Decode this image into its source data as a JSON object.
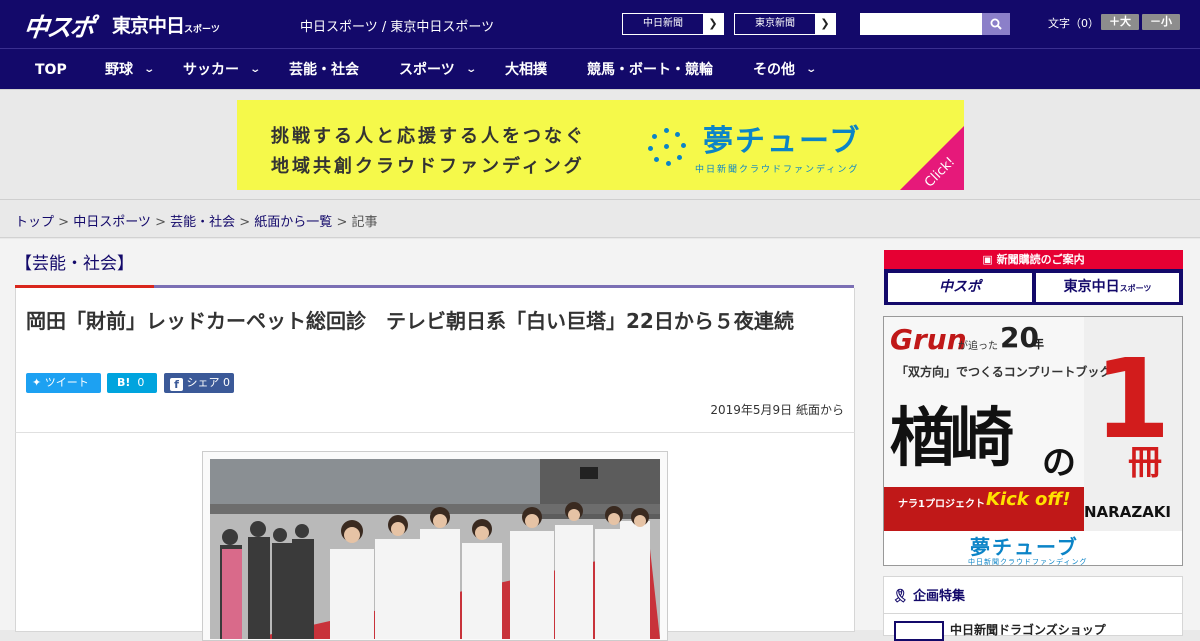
{
  "header": {
    "logo_main": "中スポ",
    "logo_tokyo": "東京中日",
    "logo_tokyo_small": "スポーツ",
    "site_name": "中日スポーツ / 東京中日スポーツ",
    "btn_chunichi": "中日新聞",
    "btn_tokyo": "東京新聞",
    "search_placeholder": "",
    "font_label": "文字（0）",
    "font_bigger": "＋大",
    "font_smaller": "－小"
  },
  "nav": {
    "items": [
      {
        "label": "TOP",
        "has_menu": false
      },
      {
        "label": "野球",
        "has_menu": true
      },
      {
        "label": "サッカー",
        "has_menu": true
      },
      {
        "label": "芸能・社会",
        "has_menu": false
      },
      {
        "label": "スポーツ",
        "has_menu": true
      },
      {
        "label": "大相撲",
        "has_menu": false
      },
      {
        "label": "競馬・ボート・競輪",
        "has_menu": false
      },
      {
        "label": "その他",
        "has_menu": true
      }
    ]
  },
  "ad_banner": {
    "line1": "挑戦する人と応援する人をつなぐ",
    "line2": "地域共創クラウドファンディング",
    "logo": "夢チューブ",
    "sub": "中日新聞クラウドファンディング",
    "click": "Click!"
  },
  "breadcrumb": {
    "items": [
      "トップ",
      "中日スポーツ",
      "芸能・社会",
      "紙面から一覧"
    ],
    "current": "記事",
    "sep": " > "
  },
  "article": {
    "category": "【芸能・社会】",
    "title": "岡田「財前」レッドカーペット総回診　テレビ朝日系「白い巨塔」22日から５夜連続",
    "tweet": "ツイート",
    "hatena_label": "B!",
    "hatena_count": "0",
    "facebook": "シェア",
    "facebook_count": "0",
    "date": "2019年5月9日 紙面から"
  },
  "sidebar": {
    "subscribe_title": "新聞購読のご案内",
    "subscribe_chunichi": "中スポ",
    "subscribe_tokyo": "東京中日",
    "subscribe_tokyo_small": "スポーツ",
    "grun_ad": {
      "brand": "Grun",
      "tagline1": "が追った",
      "years": "20",
      "years_unit": "年",
      "tagline2": "「双方向」でつくるコンプリートブック",
      "name_big": "楢崎",
      "no": "の",
      "one": "1",
      "satsu": "冊",
      "project": "ナラ1プロジェクト",
      "kickoff": "Kick off!",
      "player": "NARAZAKI",
      "footer_logo": "夢チューブ",
      "footer_sub": "中日新聞クラウドファンディング"
    },
    "feature_title": "企画特集",
    "feature_item": "中日新聞ドラゴンズショップ"
  }
}
